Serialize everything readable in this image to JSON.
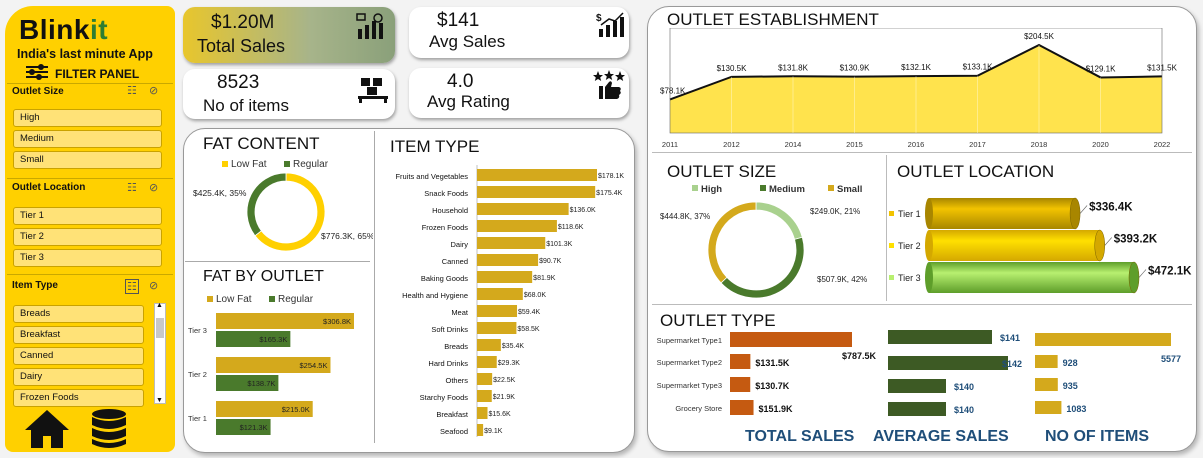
{
  "sidebar": {
    "brand_main": "Blink",
    "brand_accent": "it",
    "tagline": "India's last minute App",
    "filter_panel": "FILTER PANEL",
    "outlet_size": {
      "title": "Outlet Size",
      "items": [
        "High",
        "Medium",
        "Small"
      ]
    },
    "outlet_location": {
      "title": "Outlet Location",
      "items": [
        "Tier 1",
        "Tier 2",
        "Tier 3"
      ]
    },
    "item_type": {
      "title": "Item Type",
      "items": [
        "Breads",
        "Breakfast",
        "Canned",
        "Dairy",
        "Frozen Foods"
      ]
    },
    "icons": [
      "home-icon",
      "database-icon"
    ]
  },
  "kpis": {
    "total_sales": {
      "value": "$1.20M",
      "label": "Total Sales"
    },
    "avg_sales": {
      "value": "$141",
      "label": "Avg Sales"
    },
    "no_of_items": {
      "value": "8523",
      "label": "No of items"
    },
    "avg_rating": {
      "value": "4.0",
      "label": "Avg Rating"
    }
  },
  "colors": {
    "yellow": "#ffd000",
    "gold": "#d4a91c",
    "green": "#4a7a2c",
    "dark_green": "#3d5a24",
    "orange": "#c55a11",
    "light_green": "#a9d18e",
    "blue_text": "#1f4e79"
  },
  "chart_data": [
    {
      "id": "fat_content",
      "type": "pie",
      "title": "FAT CONTENT",
      "categories": [
        "Low Fat",
        "Regular"
      ],
      "values": [
        776.3,
        425.4
      ],
      "labels": [
        "$776.3K, 65%",
        "$425.4K, 35%"
      ]
    },
    {
      "id": "fat_by_outlet",
      "type": "bar",
      "title": "FAT BY OUTLET",
      "categories": [
        "Tier 3",
        "Tier 2",
        "Tier 1"
      ],
      "series": [
        {
          "name": "Low Fat",
          "values": [
            306.8,
            254.5,
            215.0
          ],
          "labels": [
            "$306.8K",
            "$254.5K",
            "$215.0K"
          ]
        },
        {
          "name": "Regular",
          "values": [
            165.3,
            138.7,
            121.3
          ],
          "labels": [
            "$165.3K",
            "$138.7K",
            "$121.3K"
          ]
        }
      ]
    },
    {
      "id": "item_type",
      "type": "bar",
      "title": "ITEM TYPE",
      "categories": [
        "Fruits and Vegetables",
        "Snack Foods",
        "Household",
        "Frozen Foods",
        "Dairy",
        "Canned",
        "Baking Goods",
        "Health and Hygiene",
        "Meat",
        "Soft Drinks",
        "Breads",
        "Hard Drinks",
        "Others",
        "Starchy Foods",
        "Breakfast",
        "Seafood"
      ],
      "values": [
        178.1,
        175.4,
        136.0,
        118.6,
        101.3,
        90.7,
        81.9,
        68.0,
        59.4,
        58.5,
        35.4,
        29.3,
        22.5,
        21.9,
        15.6,
        9.1
      ],
      "labels": [
        "$178.1K",
        "$175.4K",
        "$136.0K",
        "$118.6K",
        "$101.3K",
        "$90.7K",
        "$81.9K",
        "$68.0K",
        "$59.4K",
        "$58.5K",
        "$35.4K",
        "$29.3K",
        "$22.5K",
        "$21.9K",
        "$15.6K",
        "$9.1K"
      ]
    },
    {
      "id": "outlet_establishment",
      "type": "area",
      "title": "OUTLET ESTABLISHMENT",
      "x": [
        "2011",
        "2012",
        "2014",
        "2015",
        "2016",
        "2017",
        "2018",
        "2020",
        "2022"
      ],
      "values": [
        78.1,
        130.5,
        131.8,
        130.9,
        132.1,
        133.1,
        204.5,
        129.1,
        131.5
      ],
      "labels": [
        "$78.1K",
        "$130.5K",
        "$131.8K",
        "$130.9K",
        "$132.1K",
        "$133.1K",
        "$204.5K",
        "$129.1K",
        "$131.5K"
      ]
    },
    {
      "id": "outlet_size",
      "type": "pie",
      "title": "OUTLET SIZE",
      "categories": [
        "High",
        "Medium",
        "Small"
      ],
      "values": [
        249.0,
        507.9,
        444.8
      ],
      "labels": [
        "$249.0K, 21%",
        "$507.9K, 42%",
        "$444.8K, 37%"
      ]
    },
    {
      "id": "outlet_location",
      "type": "bar",
      "title": "OUTLET LOCATION",
      "categories": [
        "Tier 1",
        "Tier 2",
        "Tier 3"
      ],
      "values": [
        336.4,
        393.2,
        472.1
      ],
      "labels": [
        "$336.4K",
        "$393.2K",
        "$472.1K"
      ]
    },
    {
      "id": "outlet_type",
      "type": "table",
      "title": "OUTLET TYPE",
      "categories": [
        "Supermarket Type1",
        "Supermarket Type2",
        "Supermarket Type3",
        "Grocery Store"
      ],
      "columns": [
        "TOTAL SALES",
        "AVERAGE SALES",
        "NO OF ITEMS"
      ],
      "total_sales": [
        787.5,
        131.5,
        130.7,
        151.9
      ],
      "total_sales_labels": [
        "$787.5K",
        "$131.5K",
        "$130.7K",
        "$151.9K"
      ],
      "average_sales": [
        141,
        142,
        140,
        140
      ],
      "average_sales_labels": [
        "$141",
        "$142",
        "$140",
        "$140"
      ],
      "no_of_items": [
        5577,
        928,
        935,
        1083
      ],
      "no_of_items_labels": [
        "5577",
        "928",
        "935",
        "1083"
      ]
    }
  ]
}
